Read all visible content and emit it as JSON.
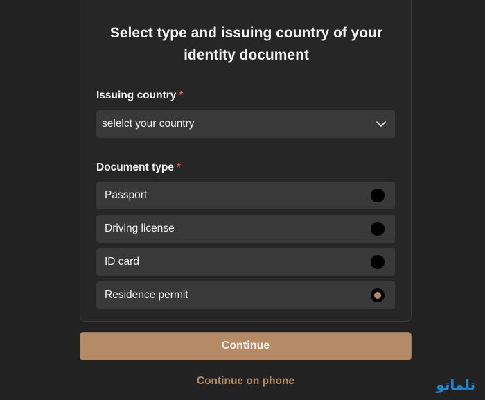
{
  "form": {
    "title": "Select type and issuing country of your identity document",
    "country_label": "Issuing country",
    "required_mark": "*",
    "country_select_value": "selelct your country",
    "document_type_label": "Document type",
    "document_options": [
      {
        "label": "Passport",
        "selected": false
      },
      {
        "label": "Driving license",
        "selected": false
      },
      {
        "label": "ID card",
        "selected": false
      },
      {
        "label": "Residence permit",
        "selected": true
      }
    ]
  },
  "actions": {
    "continue_label": "Continue",
    "phone_label": "Continue on phone"
  },
  "watermark": "تلماتو",
  "colors": {
    "background": "#222222",
    "card": "#262626",
    "field": "#393939",
    "accent": "#b58a66",
    "required": "#e0574f",
    "watermark": "#1e88d8"
  },
  "icons": {
    "select": "chevron-down-icon"
  }
}
